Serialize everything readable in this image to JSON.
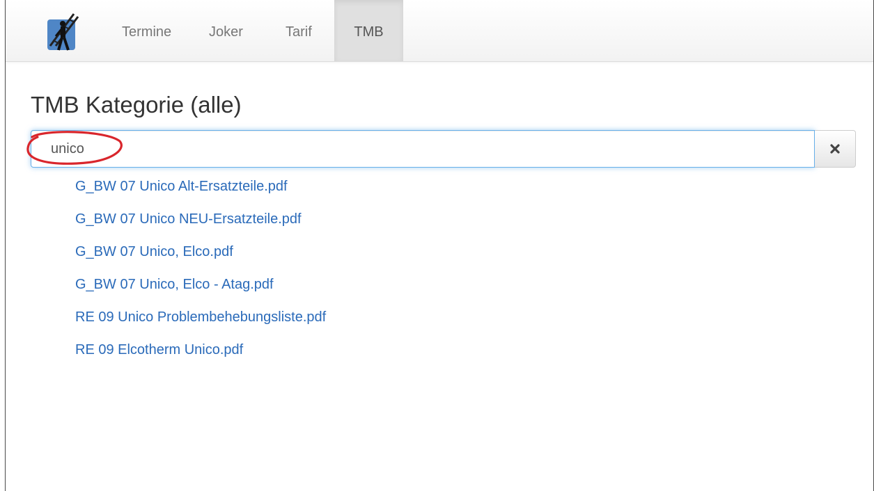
{
  "navbar": {
    "brand_icon": "chimney-sweep-logo-icon",
    "items": [
      {
        "label": "Termine",
        "active": false
      },
      {
        "label": "Joker",
        "active": false
      },
      {
        "label": "Tarif",
        "active": false
      },
      {
        "label": "TMB",
        "active": true
      }
    ]
  },
  "page": {
    "title": "TMB Kategorie (alle)"
  },
  "search": {
    "value": "unico",
    "placeholder": "",
    "clear_icon": "close-icon"
  },
  "annotation": {
    "color": "#d9262c"
  },
  "results": [
    {
      "label": "G_BW 07 Unico Alt-Ersatzteile.pdf"
    },
    {
      "label": "G_BW 07 Unico NEU-Ersatzteile.pdf"
    },
    {
      "label": "G_BW 07 Unico, Elco.pdf"
    },
    {
      "label": "G_BW 07 Unico, Elco - Atag.pdf"
    },
    {
      "label": "RE 09 Unico Problembehebungsliste.pdf"
    },
    {
      "label": "RE 09 Elcotherm Unico.pdf"
    }
  ],
  "colors": {
    "link": "#2a6ab9",
    "active_nav_bg": "#e0e0e0",
    "focus_border": "#66afe9"
  }
}
